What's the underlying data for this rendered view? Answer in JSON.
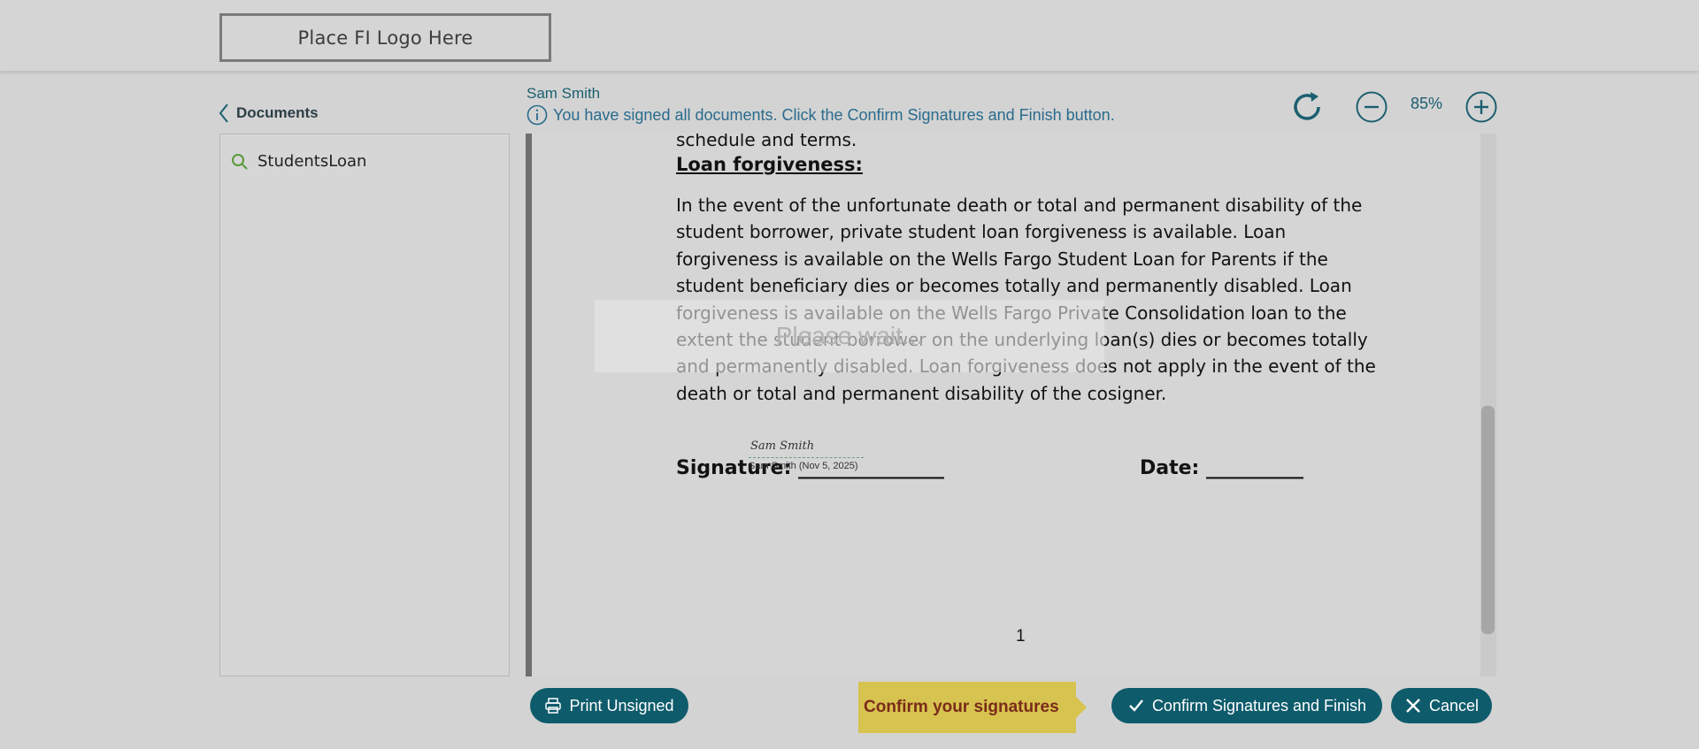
{
  "header": {
    "logo_text": "Place FI Logo Here"
  },
  "sidebar": {
    "title": "Documents",
    "items": [
      {
        "label": "StudentsLoan"
      }
    ]
  },
  "signer": {
    "name": "Sam Smith",
    "status_message": "You have signed all documents. Click the Confirm Signatures and Finish button."
  },
  "toolbar": {
    "zoom_level": "85%"
  },
  "document": {
    "cut_line": "schedule and terms.",
    "heading": "Loan forgiveness:",
    "body": "In the event of the unfortunate death or total and permanent disability of the student borrower, private student loan forgiveness is available. Loan forgiveness is available on the Wells Fargo Student Loan for Parents if the student beneficiary dies or becomes totally and permanently disabled. Loan forgiveness is available on the Wells Fargo Private Consolidation loan to the extent the student borrower on the underlying loan(s) dies or becomes totally and permanently disabled. Loan forgiveness does not apply in the event of the death or total and permanent disability of the cosigner.",
    "signature_label": "Signature: _______________",
    "date_label": "Date: __________",
    "signature_script": "Sam Smith",
    "signature_caption": "Sam Smith (Nov 5, 2025)",
    "page_number": "1"
  },
  "overlay": {
    "wait_text": "Please wait..."
  },
  "footer": {
    "print_label": "Print Unsigned",
    "callout_text": "Confirm your signatures",
    "confirm_label": "Confirm Signatures and Finish",
    "cancel_label": "Cancel"
  },
  "colors": {
    "accent": "#0e5b6b",
    "callout": "#d7c34f",
    "info": "#2a6b8c"
  }
}
